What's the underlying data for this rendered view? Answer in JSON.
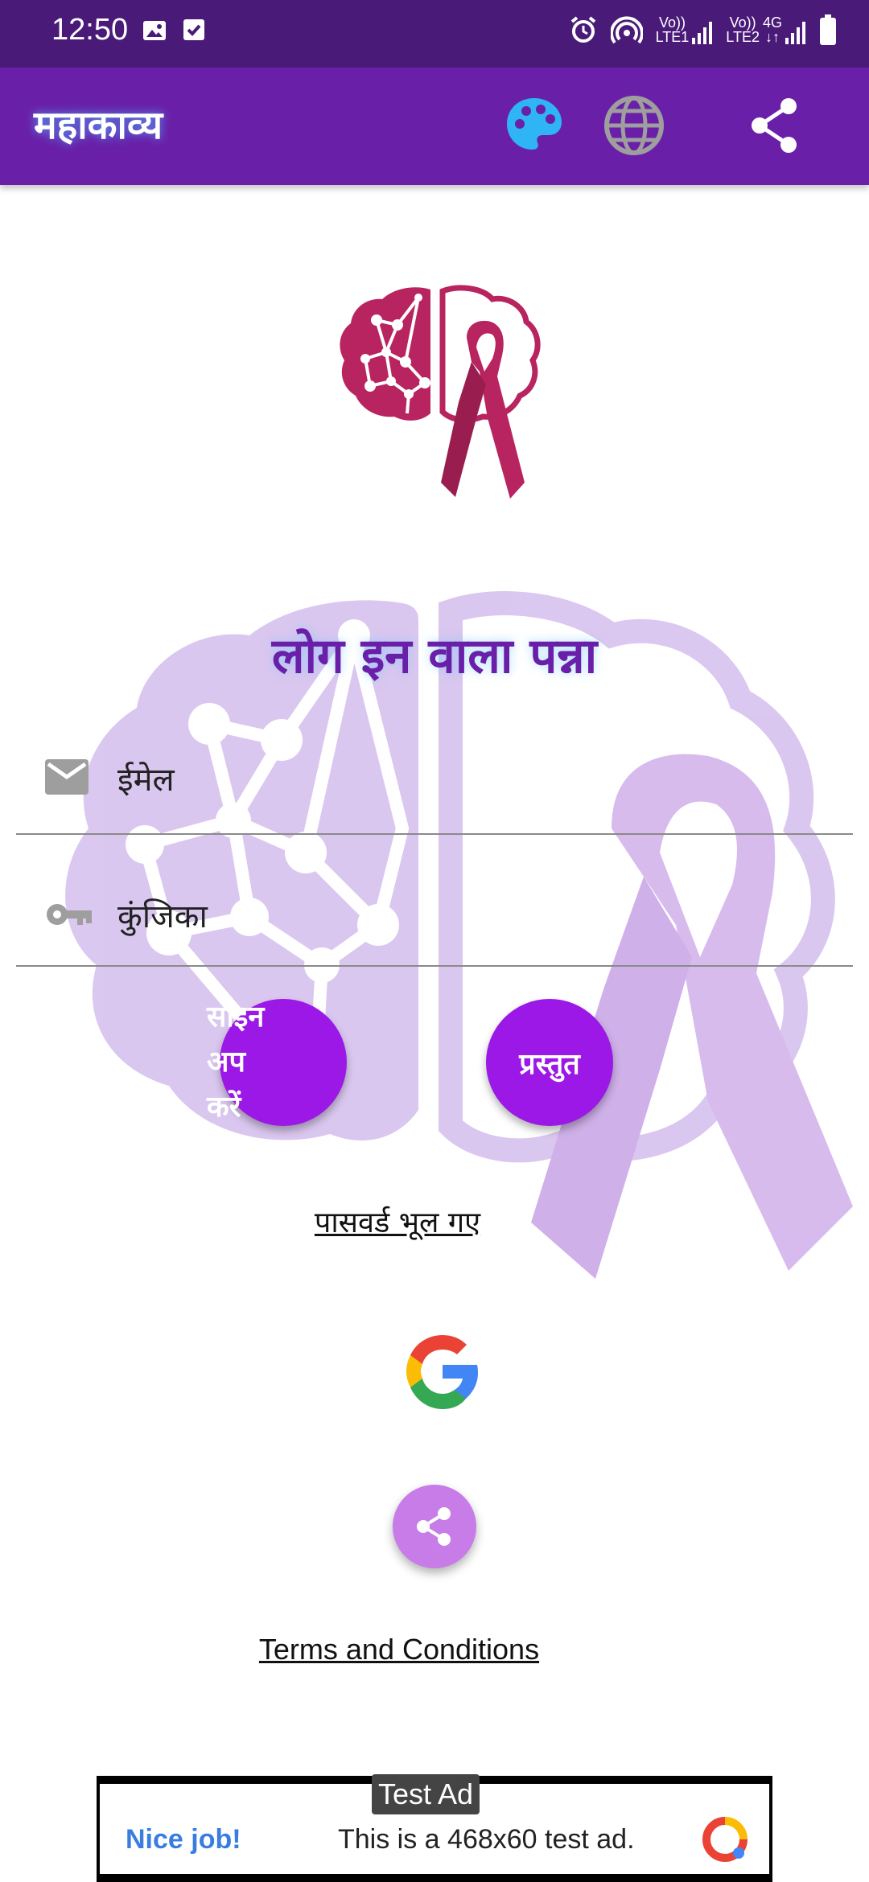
{
  "status_bar": {
    "time": "12:50",
    "net1_top": "Vo))",
    "net1_bottom": "LTE1",
    "net2_top": "Vo))",
    "net2_bottom": "LTE2",
    "net3_top": "4G"
  },
  "app_bar": {
    "title": "महाकाव्य",
    "icons": [
      "palette-icon",
      "globe-icon",
      "share-icon"
    ]
  },
  "login": {
    "page_title": "लोग इन वाला पन्ना",
    "email_label": "ईमेल",
    "password_label": "कुंजिका",
    "signup_lines": [
      "साइन",
      "अप",
      "करें"
    ],
    "submit_label": "प्रस्तुत",
    "forgot_link": "पासवर्ड भूल गए",
    "terms_link": "Terms and Conditions"
  },
  "ad": {
    "badge": "Test Ad",
    "headline": "Nice job!",
    "text": "This is a 468x60 test ad."
  },
  "colors": {
    "status_bar": "#4a1a78",
    "app_bar": "#6a1fa8",
    "button_purple": "#9b18e6",
    "share_fab": "#c77ce8",
    "logo_magenta": "#b8245f",
    "watermark": "#cfb2ea"
  }
}
